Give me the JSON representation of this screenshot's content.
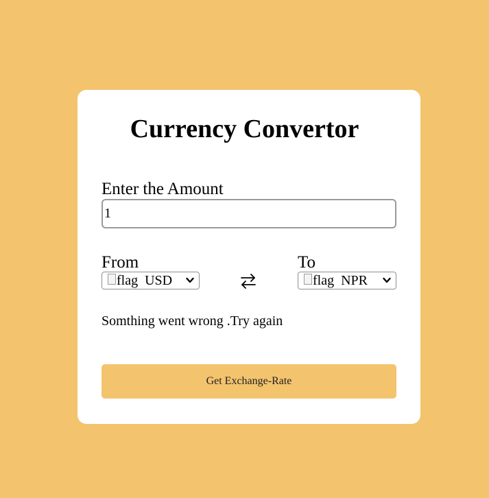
{
  "app": {
    "title": "Currency Convertor"
  },
  "amount": {
    "label": "Enter the Amount",
    "value": "1"
  },
  "from": {
    "label": "From",
    "flag_alt": "flag",
    "currency": "USD"
  },
  "to": {
    "label": "To",
    "flag_alt": "flag",
    "currency": "NPR"
  },
  "icons": {
    "swap": "swap-arrows-icon",
    "dropdown": "chevron-down-icon",
    "broken_image": "broken-image-icon"
  },
  "message": "Somthing went wrong .Try again",
  "button": {
    "label": "Get Exchange-Rate"
  },
  "colors": {
    "background": "#f3c36d",
    "card": "#ffffff",
    "button": "#f3c36d"
  }
}
